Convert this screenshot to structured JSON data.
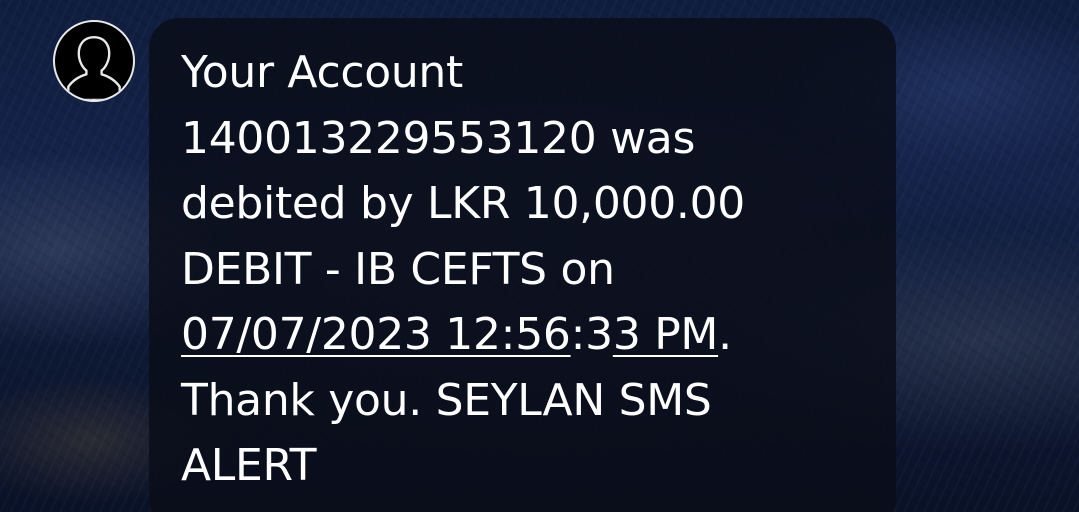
{
  "contact": {
    "avatar_icon": "person-silhouette-icon"
  },
  "message": {
    "line1": "Your Account",
    "line2": "140013229553120 was",
    "line3": "debited by LKR 10,000.00",
    "line4": "DEBIT - IB CEFTS on",
    "date_link": "07/07/2023 12:56",
    "time_middle": ":3",
    "time_link": "3 PM",
    "period": ".",
    "line6": "Thank you. SEYLAN SMS",
    "line7": "ALERT"
  },
  "colors": {
    "bubble": "#0a0e1a",
    "text": "#ffffff",
    "avatar_border": "#e9e9e9"
  }
}
